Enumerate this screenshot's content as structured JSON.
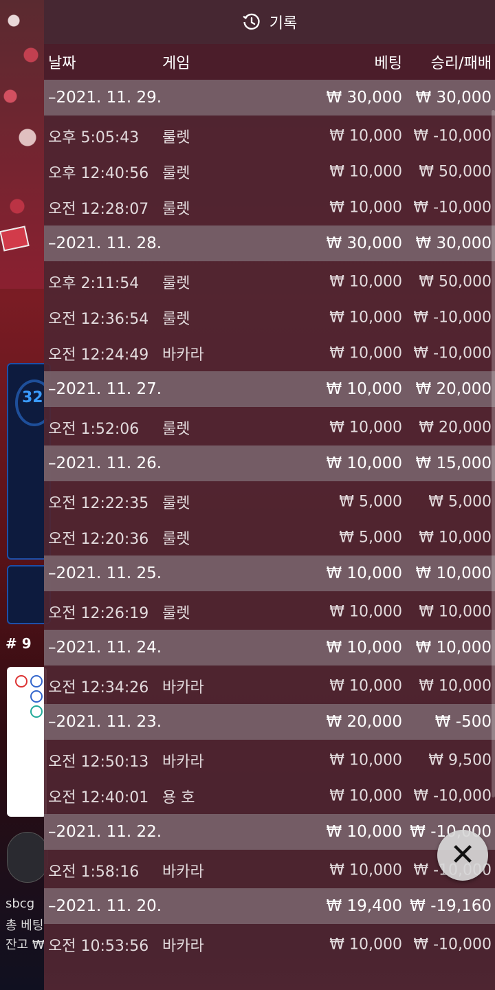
{
  "header": {
    "title": "기록",
    "icon": "history-icon"
  },
  "columns": {
    "date": "날짜",
    "game": "게임",
    "bet": "베팅",
    "win": "승리/패배"
  },
  "groups": [
    {
      "date": "–2021. 11. 29.",
      "bet": "₩ 30,000",
      "win": "₩ 30,000",
      "rows": [
        {
          "time": "오후 5:05:43",
          "game": "룰렛",
          "bet": "₩ 10,000",
          "win": "₩ -10,000"
        },
        {
          "time": "오후 12:40:56",
          "game": "룰렛",
          "bet": "₩ 10,000",
          "win": "₩ 50,000"
        },
        {
          "time": "오전 12:28:07",
          "game": "룰렛",
          "bet": "₩ 10,000",
          "win": "₩ -10,000"
        }
      ]
    },
    {
      "date": "–2021. 11. 28.",
      "bet": "₩ 30,000",
      "win": "₩ 30,000",
      "rows": [
        {
          "time": "오후 2:11:54",
          "game": "룰렛",
          "bet": "₩ 10,000",
          "win": "₩ 50,000"
        },
        {
          "time": "오전 12:36:54",
          "game": "룰렛",
          "bet": "₩ 10,000",
          "win": "₩ -10,000"
        },
        {
          "time": "오전 12:24:49",
          "game": "바카라",
          "bet": "₩ 10,000",
          "win": "₩ -10,000"
        }
      ]
    },
    {
      "date": "–2021. 11. 27.",
      "bet": "₩ 10,000",
      "win": "₩ 20,000",
      "rows": [
        {
          "time": "오전 1:52:06",
          "game": "룰렛",
          "bet": "₩ 10,000",
          "win": "₩ 20,000"
        }
      ]
    },
    {
      "date": "–2021. 11. 26.",
      "bet": "₩ 10,000",
      "win": "₩ 15,000",
      "rows": [
        {
          "time": "오전 12:22:35",
          "game": "룰렛",
          "bet": "₩ 5,000",
          "win": "₩ 5,000"
        },
        {
          "time": "오전 12:20:36",
          "game": "룰렛",
          "bet": "₩ 5,000",
          "win": "₩ 10,000"
        }
      ]
    },
    {
      "date": "–2021. 11. 25.",
      "bet": "₩ 10,000",
      "win": "₩ 10,000",
      "rows": [
        {
          "time": "오전 12:26:19",
          "game": "룰렛",
          "bet": "₩ 10,000",
          "win": "₩ 10,000"
        }
      ]
    },
    {
      "date": "–2021. 11. 24.",
      "bet": "₩ 10,000",
      "win": "₩ 10,000",
      "rows": [
        {
          "time": "오전 12:34:26",
          "game": "바카라",
          "bet": "₩ 10,000",
          "win": "₩ 10,000"
        }
      ]
    },
    {
      "date": "–2021. 11. 23.",
      "bet": "₩ 20,000",
      "win": "₩ -500",
      "rows": [
        {
          "time": "오전 12:50:13",
          "game": "바카라",
          "bet": "₩ 10,000",
          "win": "₩ 9,500"
        },
        {
          "time": "오전 12:40:01",
          "game": "용 호",
          "bet": "₩ 10,000",
          "win": "₩ -10,000"
        }
      ]
    },
    {
      "date": "–2021. 11. 22.",
      "bet": "₩ 10,000",
      "win": "₩ -10,000",
      "rows": [
        {
          "time": "오전 1:58:16",
          "game": "바카라",
          "bet": "₩ 10,000",
          "win": "₩ -10,000"
        }
      ]
    },
    {
      "date": "–2021. 11. 20.",
      "bet": "₩ 19,400",
      "win": "₩ -19,160",
      "rows": [
        {
          "time": "오전 10:53:56",
          "game": "바카라",
          "bet": "₩ 10,000",
          "win": "₩ -10,000"
        }
      ]
    }
  ],
  "background": {
    "timer_text": "32",
    "round_label": "# 9",
    "user_text": "sbcg",
    "total_bet_label": "총 베팅",
    "balance_label": "잔고 ₩"
  },
  "close_button": {
    "label": "✕"
  }
}
